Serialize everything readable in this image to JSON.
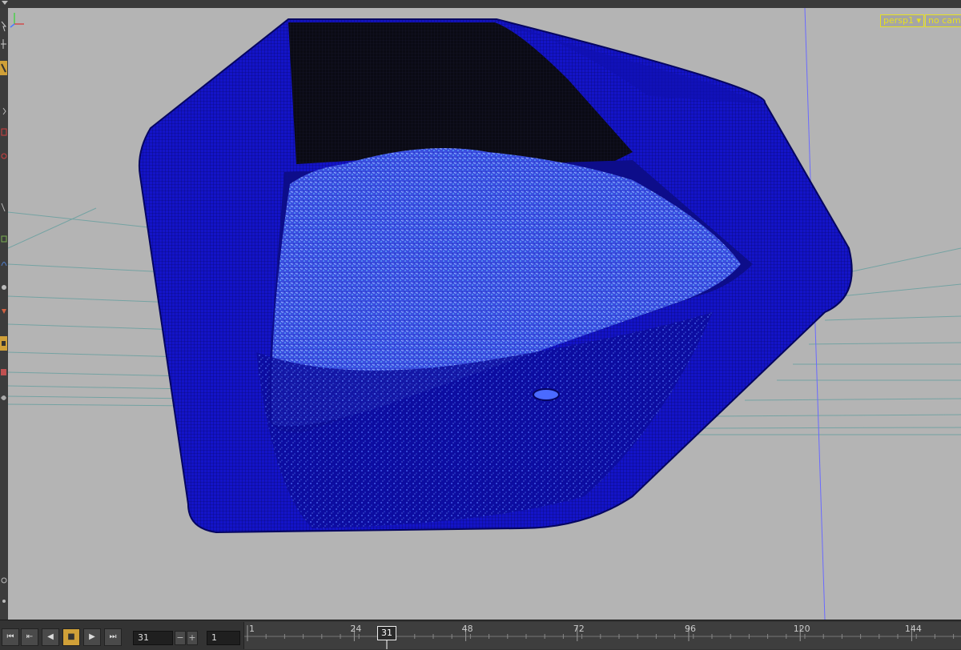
{
  "viewport": {
    "camera_menu": "persp1 ▾",
    "camera_status": "no cam",
    "background_color": "#b4b4b4",
    "mesh_color": "#1a1ad8",
    "particle_color": "#4a7aff",
    "grid_color": "#6aa0a0",
    "axis_gizmo_icon": "axis-gizmo-icon"
  },
  "toolbar": {
    "tools": [
      "select-tool-icon",
      "move-tool-icon",
      "rotate-tool-icon",
      "scale-tool-icon",
      "handle-tool-icon",
      "pose-tool-icon",
      "brush-tool-icon",
      "view-tool-icon",
      "camera-tool-icon",
      "render-tool-icon",
      "snap-tool-icon",
      "display-tool-icon"
    ]
  },
  "timeline": {
    "current_frame": "31",
    "step_value": "1",
    "playhead_label": "31",
    "ruler_ticks": [
      "1",
      "24",
      "48",
      "72",
      "96",
      "120",
      "144"
    ],
    "buttons": {
      "jump_start": "⏮",
      "step_back": "⇤",
      "play_reverse": "◀",
      "stop": "■",
      "play_forward": "▶",
      "jump_end": "⏭",
      "minus": "−",
      "plus": "+"
    }
  }
}
